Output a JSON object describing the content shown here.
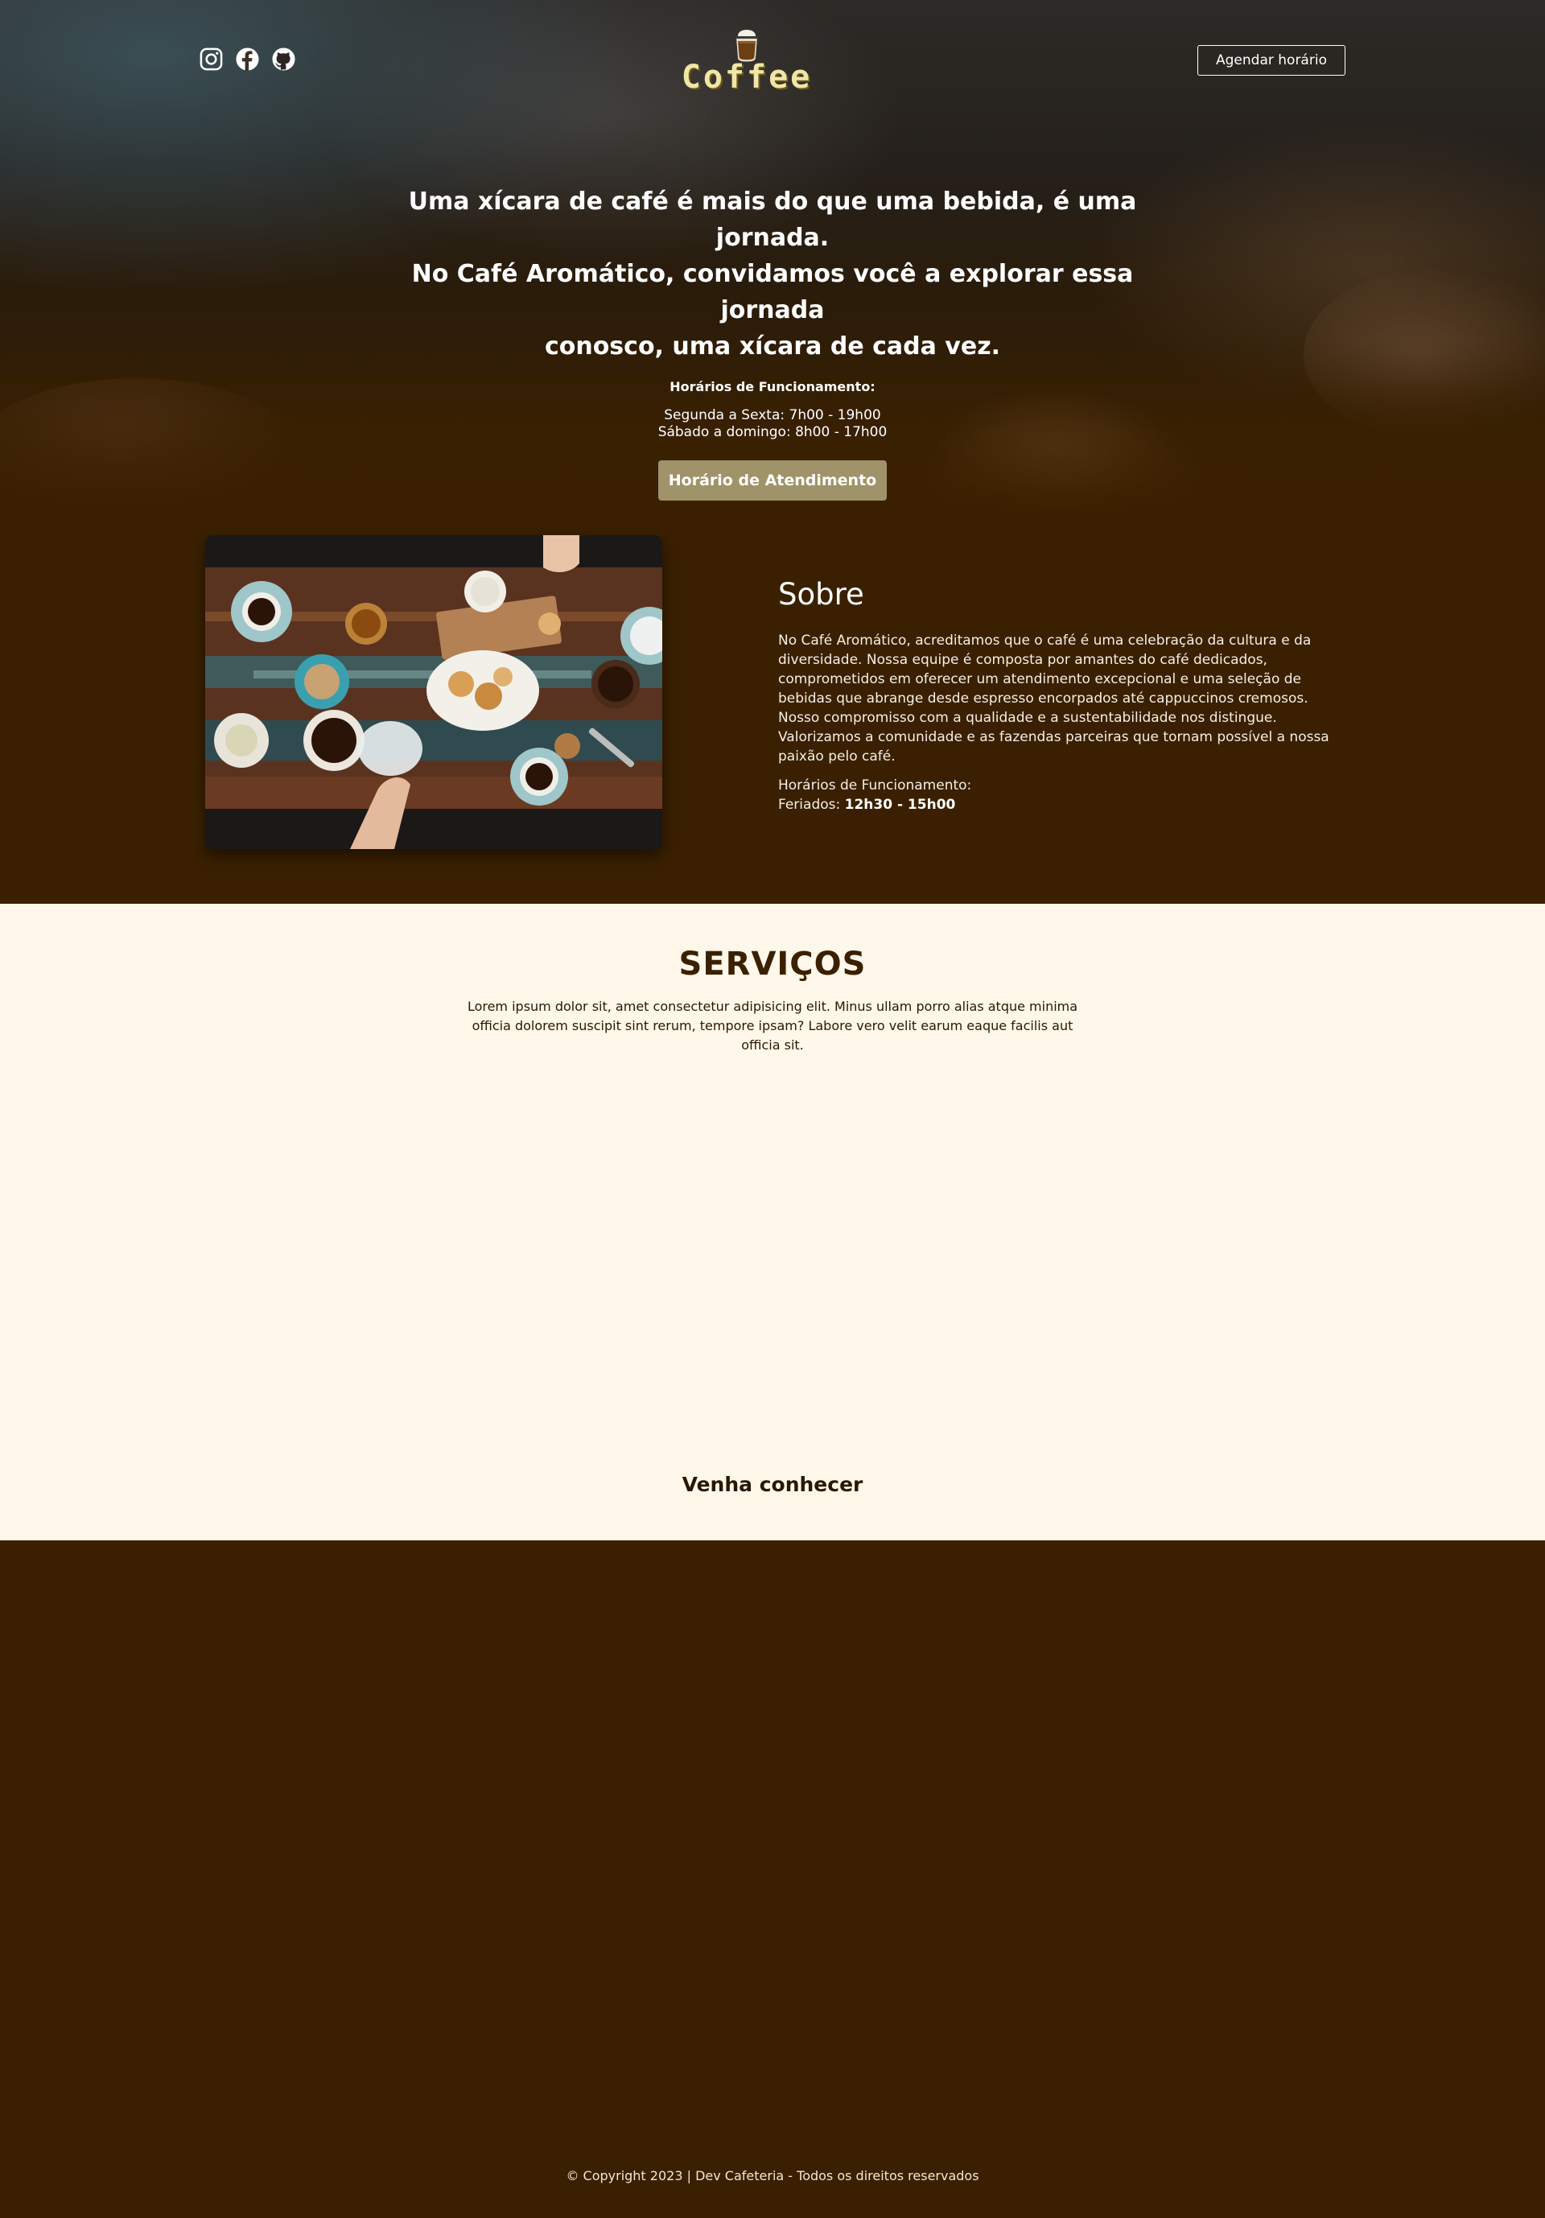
{
  "header": {
    "social": [
      {
        "icon": "instagram-icon"
      },
      {
        "icon": "facebook-icon"
      },
      {
        "icon": "github-icon"
      }
    ],
    "logo_text": "Coffee",
    "schedule_button": "Agendar horário"
  },
  "hero": {
    "title_lines": [
      "Uma xícara de café é mais do que uma bebida, é uma jornada.",
      "No Café Aromático, convidamos você a explorar essa jornada",
      "conosco, uma xícara de cada vez."
    ],
    "hours_label": "Horários de Funcionamento:",
    "hours": [
      "Segunda a Sexta: 7h00 - 19h00",
      "Sábado a domingo: 8h00 - 17h00"
    ],
    "button": "Horário de Atendimento"
  },
  "about": {
    "title": "Sobre",
    "description": "No Café Aromático, acreditamos que o café é uma celebração da cultura e da diversidade. Nossa equipe é composta por amantes do café dedicados, comprometidos em oferecer um atendimento excepcional e uma seleção de bebidas que abrange desde espresso encorpados até cappuccinos cremosos. Nosso compromisso com a qualidade e a sustentabilidade nos distingue. Valorizamos a comunidade e as fazendas parceiras que tornam possível a nossa paixão pelo café.",
    "hours_label": "Horários de Funcionamento:",
    "holidays_label": "Feriados: ",
    "holidays_value": "12h30 - 15h00"
  },
  "services": {
    "title": "SERVIÇOS",
    "description": "Lorem ipsum dolor sit, amet consectetur adipisicing elit. Minus ullam porro alias atque minima officia dolorem suscipit sint rerum, tempore ipsam? Labore vero velit earum eaque facilis aut officia sit.",
    "cta": "Venha conhecer"
  },
  "footer": {
    "copyright": "© Copyright 2023 | Dev Cafeteria - Todos os direitos reservados"
  },
  "colors": {
    "brown_bg": "#3a2000",
    "cream_bg": "#fff7ea",
    "accent_button": "#a0936a",
    "logo_text": "#efe6a8"
  }
}
